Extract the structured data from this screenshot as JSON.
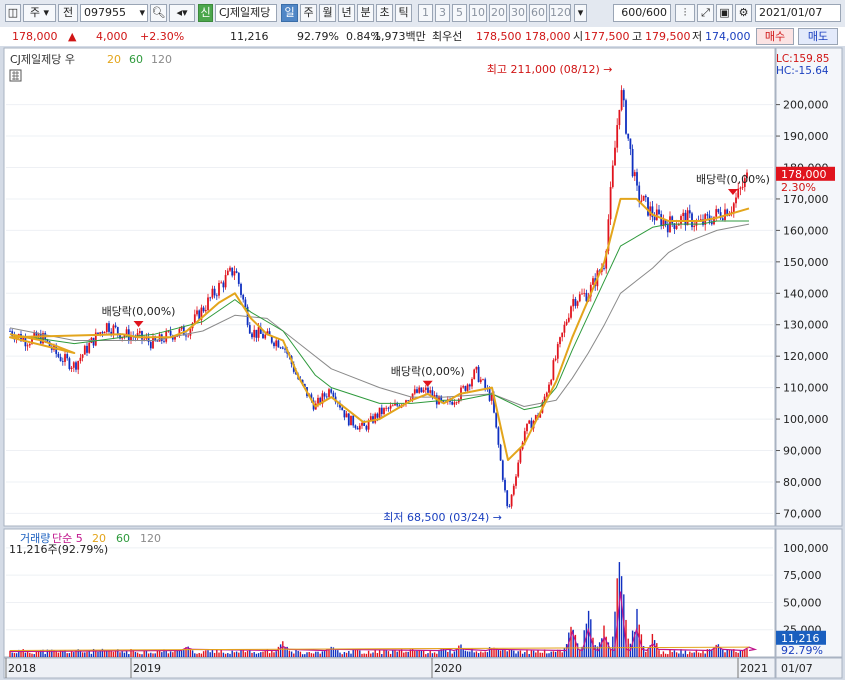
{
  "toolbar": {
    "market": "주",
    "mode": "전",
    "code": "097955",
    "badge_new": "신",
    "stock_name": "CJ제일제당",
    "periods": [
      "일",
      "주",
      "월",
      "년",
      "분",
      "초",
      "틱"
    ],
    "active_period": "일",
    "intervals": [
      "1",
      "3",
      "5",
      "10",
      "20",
      "30",
      "60",
      "120"
    ],
    "count_value": "600",
    "count_total": "/600",
    "date": "2021/01/07"
  },
  "quote": {
    "price": "178,000",
    "up_mark": "▲",
    "change": "4,000",
    "change_pct": "+2.30%",
    "volume": "11,216",
    "volume_ratio": "92.79%",
    "turnover": "0.84%",
    "amount": "1,973백만",
    "best_ask_label": "최우선",
    "best_ask": "178,500",
    "best_bid": "178,000",
    "open_label": "시",
    "open": "177,500",
    "high_label": "고",
    "high": "179,500",
    "low_label": "저",
    "low": "174,000",
    "buy_button": "매수",
    "sell_button": "매도"
  },
  "colors": {
    "up": "#e0131d",
    "down": "#1030c0",
    "ma5": "#e3a51c",
    "ma20": "#e3a51c",
    "ma60": "#2e9a3c",
    "ma120": "#8a8a8a",
    "vol_simple": "#c0148c"
  },
  "chart_data": [
    {
      "type": "line",
      "subtype": "candlestick",
      "legend": [
        {
          "name": "CJ제일제당 우",
          "color": "#333333"
        },
        {
          "name": "20",
          "color": "#e3a51c"
        },
        {
          "name": "60",
          "color": "#2e9a3c"
        },
        {
          "name": "120",
          "color": "#8a8a8a"
        }
      ],
      "x_ticks": [
        "2018",
        "2019",
        "2020",
        "2021"
      ],
      "x_last_label": "01/07",
      "ylim": [
        66000,
        218000
      ],
      "y_ticks": [
        70000,
        80000,
        90000,
        100000,
        110000,
        120000,
        130000,
        140000,
        150000,
        160000,
        170000,
        180000,
        190000,
        200000
      ],
      "y_tick_labels": [
        "70,000",
        "80,000",
        "90,000",
        "100,000",
        "110,000",
        "120,000",
        "130,000",
        "140,000",
        "150,000",
        "160,000",
        "170,000",
        "180,000",
        "190,000",
        "200,000"
      ],
      "lc_label": "LC:159.85",
      "hc_label": "HC:-15.64",
      "current_price_tag": "178,000",
      "current_pct_tag": "2.30%",
      "close_path": [
        [
          "2018-01",
          128000
        ],
        [
          "2018-02",
          125000
        ],
        [
          "2018-04",
          126000
        ],
        [
          "2018-05",
          120000
        ],
        [
          "2018-06",
          117000
        ],
        [
          "2018-07",
          124000
        ],
        [
          "2018-09",
          130000
        ],
        [
          "2018-10",
          127000
        ],
        [
          "2018-12",
          126000
        ],
        [
          "2019-01",
          124000
        ],
        [
          "2019-02",
          127000
        ],
        [
          "2019-04",
          128000
        ],
        [
          "2019-05",
          135000
        ],
        [
          "2019-06",
          142000
        ],
        [
          "2019-07",
          148000
        ],
        [
          "2019-08",
          128000
        ],
        [
          "2019-09",
          126000
        ],
        [
          "2019-10",
          124000
        ],
        [
          "2019-11",
          112000
        ],
        [
          "2019-12",
          104000
        ],
        [
          "2020-01",
          110000
        ],
        [
          "2020-01b",
          100000
        ],
        [
          "2020-02",
          97000
        ],
        [
          "2020-03",
          102000
        ],
        [
          "2020-04",
          104000
        ],
        [
          "2020-05",
          108000
        ],
        [
          "2020-06",
          109000
        ],
        [
          "2020-07",
          104000
        ],
        [
          "2020-08",
          108000
        ],
        [
          "2020-08b",
          115000
        ],
        [
          "2020-09",
          106000
        ],
        [
          "2020-09b",
          70000
        ],
        [
          "2020-10",
          96000
        ],
        [
          "2020-10b",
          102000
        ],
        [
          "2020-11",
          120000
        ],
        [
          "2020-11b",
          138000
        ],
        [
          "2020-12",
          140000
        ],
        [
          "2020-12b",
          150000
        ],
        [
          "2021-01",
          205000
        ],
        [
          "2021-01b",
          172000
        ],
        [
          "2021-02",
          165000
        ],
        [
          "2021-03",
          162000
        ],
        [
          "2021-04",
          164000
        ],
        [
          "2021-05",
          162000
        ],
        [
          "2021-06",
          165000
        ],
        [
          "2021-06b",
          168000
        ],
        [
          "2021-07",
          178000
        ]
      ],
      "ma20": [
        [
          "2018-01",
          127000
        ],
        [
          "2018-04",
          125000
        ],
        [
          "2018-06",
          121000
        ],
        [
          "2018-08",
          126000
        ],
        [
          "2018-10",
          127000
        ],
        [
          "2018-12",
          126000
        ],
        [
          "2019-02",
          126000
        ],
        [
          "2019-04",
          128000
        ],
        [
          "2019-06",
          137000
        ],
        [
          "2019-07",
          140000
        ],
        [
          "2019-08",
          132000
        ],
        [
          "2019-09",
          127000
        ],
        [
          "2019-10",
          125000
        ],
        [
          "2019-11",
          113000
        ],
        [
          "2019-12",
          104000
        ],
        [
          "2020-01",
          107000
        ],
        [
          "2020-02",
          99000
        ],
        [
          "2020-03",
          100000
        ],
        [
          "2020-04",
          103000
        ],
        [
          "2020-05",
          106000
        ],
        [
          "2020-06",
          108000
        ],
        [
          "2020-07",
          105000
        ],
        [
          "2020-08",
          108000
        ],
        [
          "2020-09",
          110000
        ],
        [
          "2020-09b",
          87000
        ],
        [
          "2020-10",
          92000
        ],
        [
          "2020-11",
          112000
        ],
        [
          "2020-11b",
          126000
        ],
        [
          "2020-12",
          138000
        ],
        [
          "2020-12b",
          150000
        ],
        [
          "2021-01",
          170000
        ],
        [
          "2021-01b",
          170000
        ],
        [
          "2021-02",
          165000
        ],
        [
          "2021-03",
          163000
        ],
        [
          "2021-04",
          163000
        ],
        [
          "2021-05",
          163000
        ],
        [
          "2021-06",
          164000
        ],
        [
          "2021-07",
          167000
        ]
      ],
      "ma60": [
        [
          "2018-01",
          127000
        ],
        [
          "2018-06",
          124000
        ],
        [
          "2018-10",
          126000
        ],
        [
          "2019-01",
          127000
        ],
        [
          "2019-05",
          131000
        ],
        [
          "2019-07",
          138000
        ],
        [
          "2019-08",
          134000
        ],
        [
          "2019-10",
          128000
        ],
        [
          "2019-12",
          114000
        ],
        [
          "2020-01",
          110000
        ],
        [
          "2020-03",
          105000
        ],
        [
          "2020-05",
          105000
        ],
        [
          "2020-07",
          106000
        ],
        [
          "2020-08",
          106000
        ],
        [
          "2020-09",
          108000
        ],
        [
          "2020-10",
          103000
        ],
        [
          "2020-10b",
          104000
        ],
        [
          "2020-11",
          110000
        ],
        [
          "2020-11b",
          122000
        ],
        [
          "2020-12",
          133000
        ],
        [
          "2020-12b",
          144000
        ],
        [
          "2021-01",
          155000
        ],
        [
          "2021-02",
          161000
        ],
        [
          "2021-03",
          162000
        ],
        [
          "2021-04",
          162000
        ],
        [
          "2021-05",
          162000
        ],
        [
          "2021-06",
          163000
        ],
        [
          "2021-07",
          163000
        ]
      ],
      "ma120": [
        [
          "2018-01",
          129000
        ],
        [
          "2018-06",
          125000
        ],
        [
          "2018-10",
          125000
        ],
        [
          "2019-01",
          125000
        ],
        [
          "2019-05",
          128000
        ],
        [
          "2019-07",
          133000
        ],
        [
          "2019-09",
          132000
        ],
        [
          "2019-11",
          124000
        ],
        [
          "2020-01",
          116000
        ],
        [
          "2020-03",
          110000
        ],
        [
          "2020-05",
          107000
        ],
        [
          "2020-07",
          107000
        ],
        [
          "2020-09",
          108000
        ],
        [
          "2020-10",
          104000
        ],
        [
          "2020-11",
          106000
        ],
        [
          "2020-11b",
          113000
        ],
        [
          "2020-12",
          121000
        ],
        [
          "2020-12b",
          130000
        ],
        [
          "2021-01",
          140000
        ],
        [
          "2021-02",
          148000
        ],
        [
          "2021-03",
          153000
        ],
        [
          "2021-04",
          156000
        ],
        [
          "2021-05",
          158000
        ],
        [
          "2021-06",
          160000
        ],
        [
          "2021-07",
          162000
        ]
      ],
      "annotations": [
        {
          "text": "최고 211,000 (08/12)",
          "x": "2021-01",
          "y": 211000,
          "color": "#d01515",
          "kind": "high"
        },
        {
          "text": "최저 68,500 (03/24)",
          "x": "2020-09b",
          "y": 68500,
          "color": "#1a3fbf",
          "kind": "low"
        },
        {
          "text": "배당락(0,00%)",
          "x": "2018-12",
          "y": 128000,
          "kind": "dividend"
        },
        {
          "text": "배당락(0,00%)",
          "x": "2020-06",
          "y": 109000,
          "kind": "dividend"
        },
        {
          "text": "배당락(0,00%)",
          "x": "2021-06b",
          "y": 170000,
          "kind": "dividend"
        }
      ]
    },
    {
      "type": "bar",
      "legend": [
        {
          "name": "거래량",
          "color": "#1a5fbf"
        },
        {
          "name": "단순 5",
          "color": "#c0148c"
        },
        {
          "name": "20",
          "color": "#e3a51c"
        },
        {
          "name": "60",
          "color": "#2e9a3c"
        },
        {
          "name": "120",
          "color": "#8a8a8a"
        }
      ],
      "subtitle": "11,216주(92.79%)",
      "ylim": [
        0,
        110000
      ],
      "y_ticks": [
        25000,
        50000,
        75000,
        100000
      ],
      "y_tick_labels": [
        "25,000",
        "50,000",
        "75,000",
        "100,000"
      ],
      "current_volume_tag": "11,216",
      "current_pct_tag": "92.79%",
      "spikes": [
        [
          "2019-04",
          14000
        ],
        [
          "2019-10",
          16000
        ],
        [
          "2020-01",
          12000
        ],
        [
          "2020-07",
          11000
        ],
        [
          "2020-08",
          13000
        ],
        [
          "2020-09",
          12000
        ],
        [
          "2020-11b",
          38000
        ],
        [
          "2020-12",
          42000
        ],
        [
          "2020-12b",
          30000
        ],
        [
          "2021-01",
          100000
        ],
        [
          "2021-01b",
          42000
        ],
        [
          "2021-02",
          20000
        ],
        [
          "2021-06",
          16000
        ],
        [
          "2021-07",
          15000
        ]
      ]
    }
  ]
}
